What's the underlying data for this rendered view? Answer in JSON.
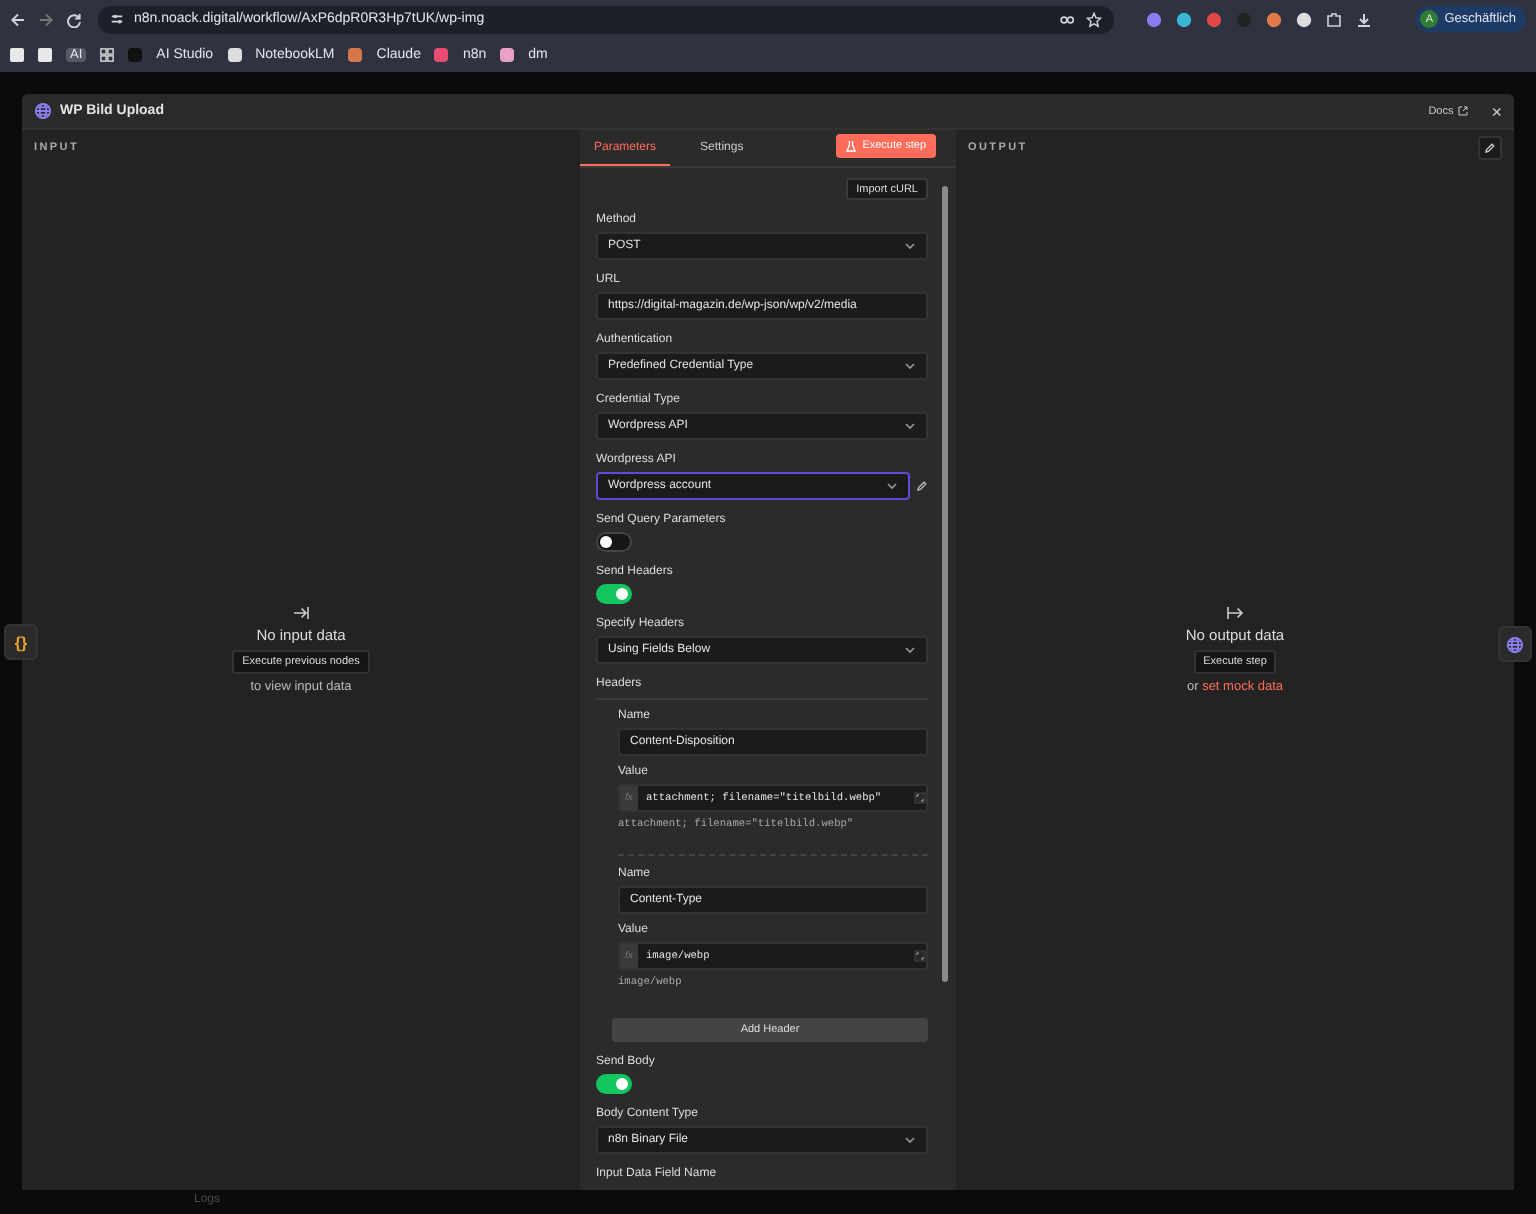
{
  "browser": {
    "url": "n8n.noack.digital/workflow/AxP6dpR0R3Hp7tUK/wp-img",
    "profile_initial": "A",
    "profile": "Geschäftlich",
    "bookmarks": [
      {
        "kind": "square"
      },
      {
        "kind": "square"
      },
      {
        "kind": "boxed",
        "label": "AI"
      },
      {
        "kind": "grid"
      },
      {
        "kind": "link",
        "label": "AI Studio",
        "color": "#111111"
      },
      {
        "kind": "link",
        "label": "NotebookLM",
        "color": "#dddddd"
      },
      {
        "kind": "link",
        "label": "Claude",
        "color": "#d9774a"
      },
      {
        "kind": "link",
        "label": "n8n",
        "color": "#ea4b71"
      },
      {
        "kind": "link",
        "label": "dm",
        "color": "#e8a0c8"
      }
    ]
  },
  "modal": {
    "title": "WP Bild Upload",
    "docs": "Docs",
    "close": "×"
  },
  "input_panel": {
    "heading": "INPUT",
    "message": "No input data",
    "button": "Execute previous nodes",
    "hint": "to view input data",
    "side_tab": "{}"
  },
  "parameters": {
    "tabs": [
      {
        "label": "Parameters",
        "selected": true
      },
      {
        "label": "Settings",
        "selected": false
      }
    ],
    "execute": "Execute step",
    "import": "Import cURL",
    "fields": [
      {
        "kind": "select",
        "label": "Method",
        "value": "POST"
      },
      {
        "kind": "text",
        "label": "URL",
        "value": "https://digital-magazin.de/wp-json/wp/v2/media"
      },
      {
        "kind": "select",
        "label": "Authentication",
        "value": "Predefined Credential Type"
      },
      {
        "kind": "select",
        "label": "Credential Type",
        "value": "Wordpress API"
      },
      {
        "kind": "credential",
        "label": "Wordpress API",
        "value": "Wordpress account",
        "focused": true
      },
      {
        "kind": "toggle",
        "label": "Send Query Parameters",
        "on": false
      },
      {
        "kind": "toggle",
        "label": "Send Headers",
        "on": true
      },
      {
        "kind": "select",
        "label": "Specify Headers",
        "value": "Using Fields Below"
      },
      {
        "kind": "headers",
        "label": "Headers",
        "add": "Add Header",
        "items": [
          {
            "name_label": "Name",
            "name": "Content-Disposition",
            "value_label": "Value",
            "fx": "fx",
            "value": "attachment; filename=\"titelbild.webp\"",
            "preview": "attachment; filename=\"titelbild.webp\""
          },
          {
            "name_label": "Name",
            "name": "Content-Type",
            "value_label": "Value",
            "fx": "fx",
            "value": "image/webp",
            "preview": "image/webp"
          }
        ]
      },
      {
        "kind": "toggle",
        "label": "Send Body",
        "on": true
      },
      {
        "kind": "select",
        "label": "Body Content Type",
        "value": "n8n Binary File"
      },
      {
        "kind": "label",
        "label": "Input Data Field Name"
      }
    ]
  },
  "output_panel": {
    "heading": "OUTPUT",
    "message": "No output data",
    "button": "Execute step",
    "or": "or",
    "link": "set mock data"
  },
  "footer": {
    "label": "Logs"
  }
}
